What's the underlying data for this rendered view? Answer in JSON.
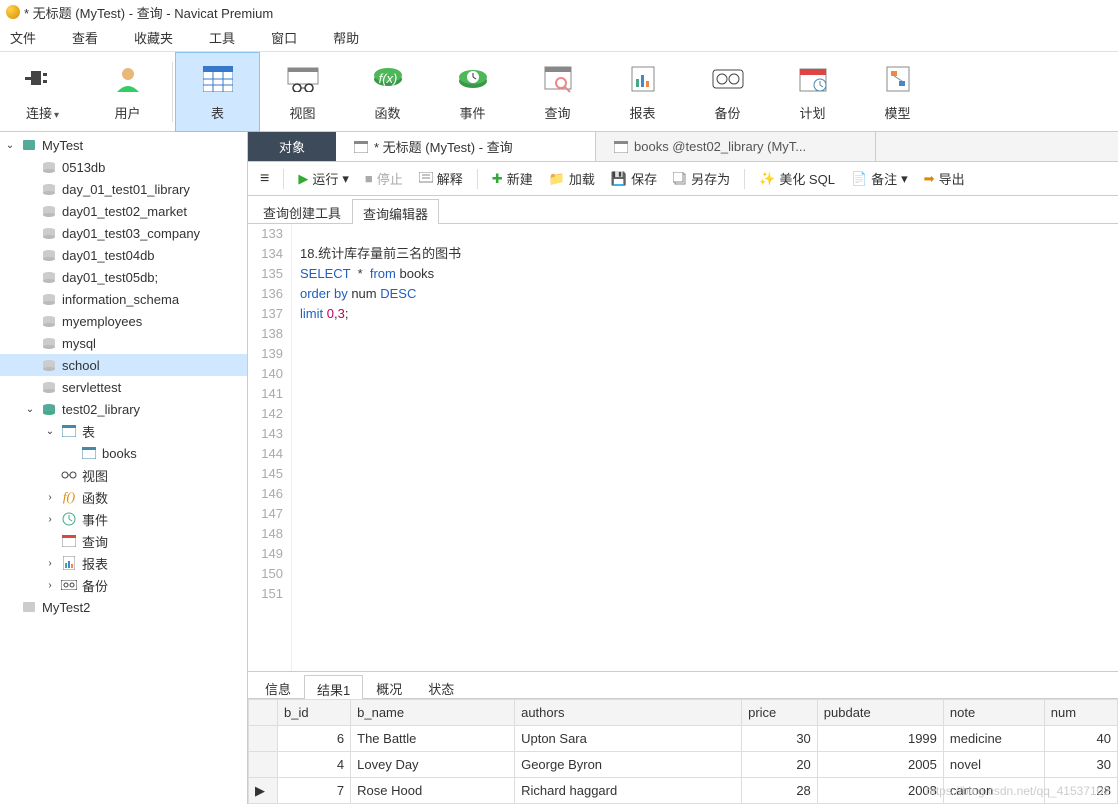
{
  "title": "* 无标题 (MyTest) - 查询 - Navicat Premium",
  "menu": {
    "file": "文件",
    "view": "查看",
    "fav": "收藏夹",
    "tool": "工具",
    "win": "窗口",
    "help": "帮助"
  },
  "toolbar": {
    "connect": "连接",
    "user": "用户",
    "table": "表",
    "viewitm": "视图",
    "func": "函数",
    "event": "事件",
    "query": "查询",
    "report": "报表",
    "backup": "备份",
    "plan": "计划",
    "model": "模型"
  },
  "tree": {
    "mytest": "MyTest",
    "d0513": "0513db",
    "d1": "day_01_test01_library",
    "d2": "day01_test02_market",
    "d3": "day01_test03_company",
    "d4": "day01_test04db",
    "d5": "day01_test05db;",
    "info": "information_schema",
    "myemp": "myemployees",
    "mysql": "mysql",
    "school": "school",
    "servlet": "servlettest",
    "test02": "test02_library",
    "tables": "表",
    "books": "books",
    "views": "视图",
    "funcs": "函数",
    "events": "事件",
    "queries": "查询",
    "reports": "报表",
    "backups": "备份",
    "mytest2": "MyTest2"
  },
  "tabs": {
    "obj": "对象",
    "tab1": "* 无标题 (MyTest) - 查询",
    "tab2": "books @test02_library (MyT..."
  },
  "subtool": {
    "run": "运行",
    "stop": "停止",
    "explain": "解释",
    "new": "新建",
    "load": "加载",
    "save": "保存",
    "saveas": "另存为",
    "beautify": "美化 SQL",
    "note": "备注",
    "export": "导出"
  },
  "querytabs": {
    "builder": "查询创建工具",
    "editor": "查询编辑器"
  },
  "editor": {
    "lines": [
      "133",
      "134",
      "135",
      "136",
      "137",
      "138",
      "139",
      "140",
      "141",
      "142",
      "143",
      "144",
      "145",
      "146",
      "147",
      "148",
      "149",
      "150",
      "151"
    ],
    "code": {
      "l134_pre": "18.统计库存量前三名的图书",
      "l135_select": "SELECT",
      "l135_star": "  * ",
      "l135_from": " from",
      "l135_books": " books",
      "l136_order": "order",
      "l136_by": " by",
      "l136_num": " num ",
      "l136_desc": "DESC",
      "l137_limit": "limit ",
      "l137_a": "0",
      "l137_c": ",",
      "l137_b": "3",
      "l137_sc": ";"
    }
  },
  "restabs": {
    "info": "信息",
    "result1": "结果1",
    "profile": "概况",
    "status": "状态"
  },
  "grid": {
    "headers": {
      "bid": "b_id",
      "bname": "b_name",
      "authors": "authors",
      "price": "price",
      "pubdate": "pubdate",
      "note": "note",
      "num": "num"
    },
    "rows": [
      {
        "bid": "6",
        "bname": "The Battle",
        "authors": "Upton Sara",
        "price": "30",
        "pubdate": "1999",
        "note": "medicine",
        "num": "40"
      },
      {
        "bid": "4",
        "bname": "Lovey Day",
        "authors": "George Byron",
        "price": "20",
        "pubdate": "2005",
        "note": "novel",
        "num": "30"
      },
      {
        "bid": "7",
        "bname": "Rose Hood",
        "authors": "Richard haggard",
        "price": "28",
        "pubdate": "2008",
        "note": "cartoon",
        "num": "28"
      }
    ]
  },
  "watermark": "https://blog.csdn.net/qq_41537102"
}
